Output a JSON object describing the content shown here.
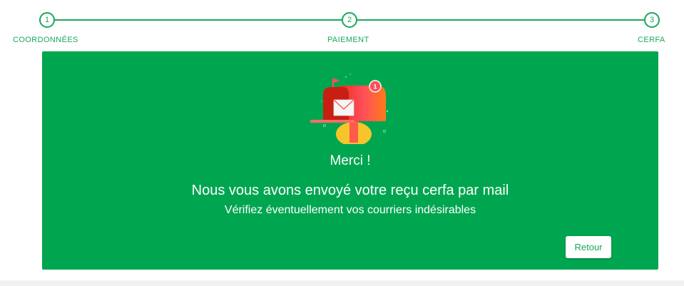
{
  "stepper": {
    "steps": [
      {
        "number": "1",
        "label": "COORDONNÉES"
      },
      {
        "number": "2",
        "label": "PAIEMENT"
      },
      {
        "number": "3",
        "label": "CERFA"
      }
    ]
  },
  "card": {
    "title": "Merci !",
    "subtitle": "Nous vous avons envoyé votre reçu cerfa par mail",
    "note": "Vérifiez éventuellement vos courriers indésirables",
    "back_label": "Retour",
    "mailbox_badge": "1"
  },
  "colors": {
    "accent": "#19a85a",
    "card_background": "#00a64f",
    "mailbox_red": "#e02a1c",
    "mailbox_yellow": "#f7c42b"
  },
  "icons": {
    "mailbox": "mailbox-illustration"
  }
}
